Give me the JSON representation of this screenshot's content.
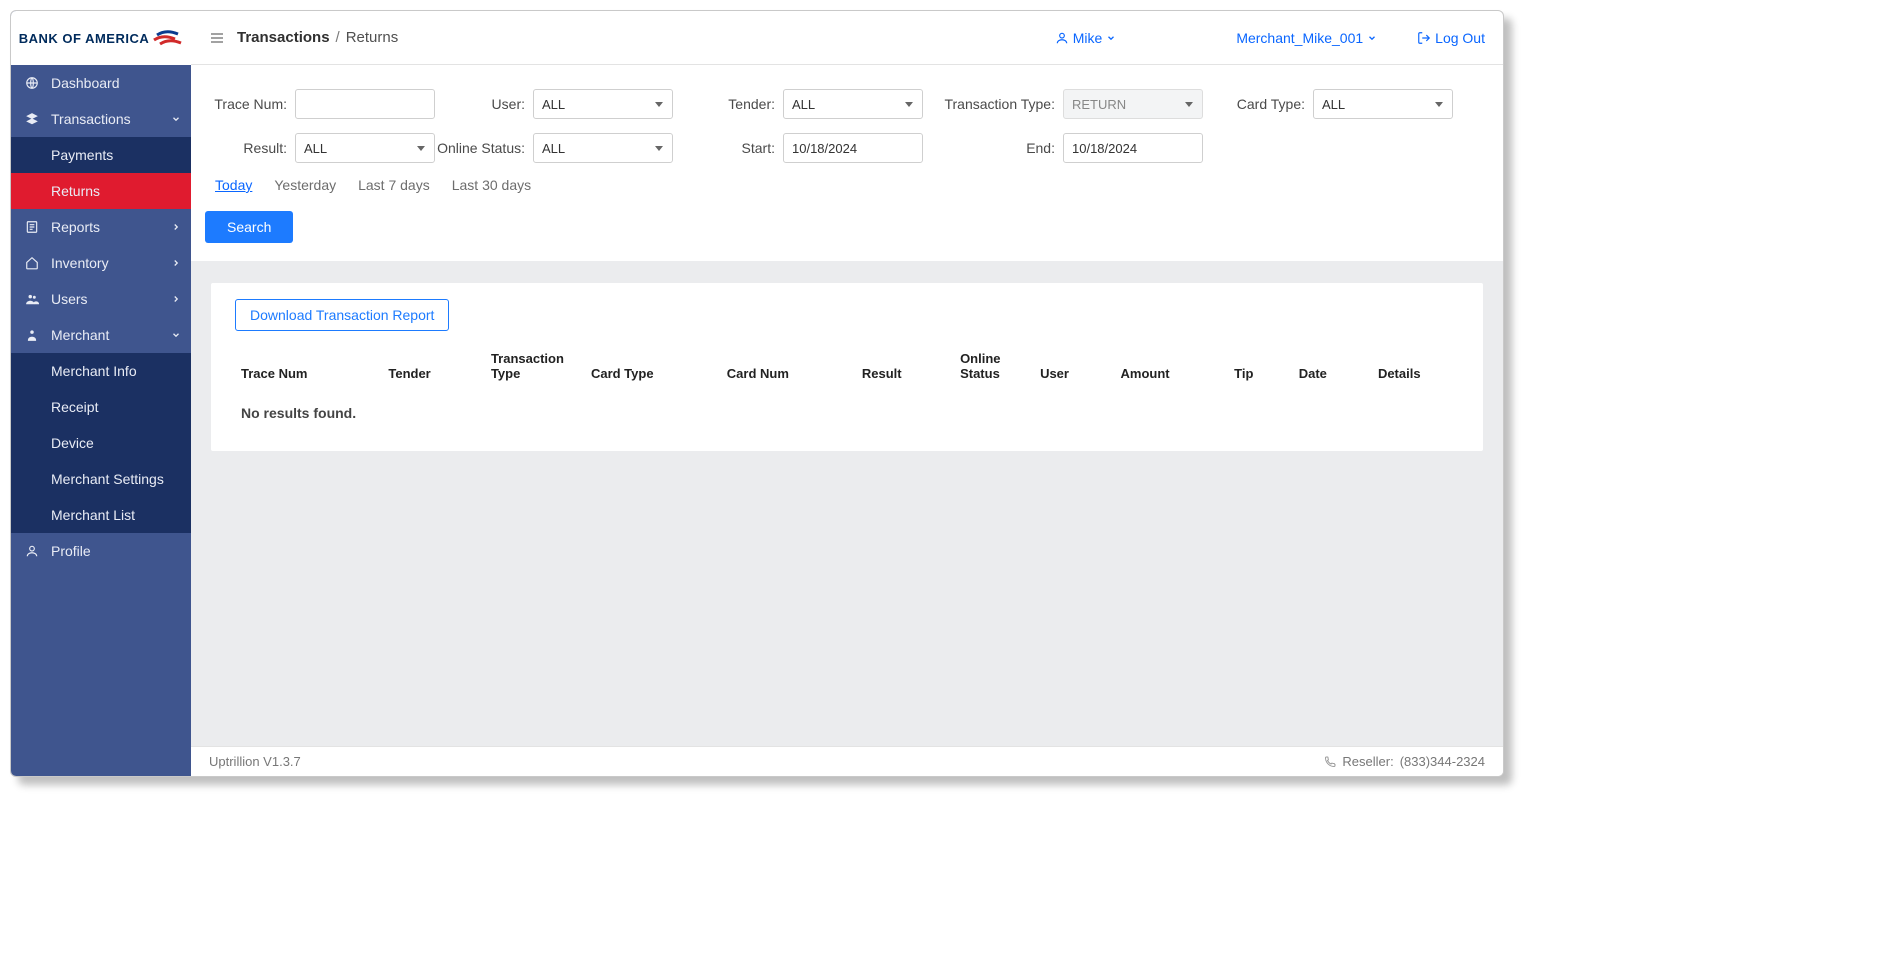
{
  "logo_text": "BANK OF AMERICA",
  "sidebar": {
    "items": [
      {
        "label": "Dashboard"
      },
      {
        "label": "Transactions"
      },
      {
        "label": "Payments"
      },
      {
        "label": "Returns"
      },
      {
        "label": "Reports"
      },
      {
        "label": "Inventory"
      },
      {
        "label": "Users"
      },
      {
        "label": "Merchant"
      },
      {
        "label": "Merchant Info"
      },
      {
        "label": "Receipt"
      },
      {
        "label": "Device"
      },
      {
        "label": "Merchant Settings"
      },
      {
        "label": "Merchant List"
      },
      {
        "label": "Profile"
      }
    ]
  },
  "breadcrumb": {
    "main": "Transactions",
    "sep": "/",
    "sub": "Returns"
  },
  "header": {
    "user": "Mike",
    "merchant": "Merchant_Mike_001",
    "logout": "Log Out"
  },
  "filters": {
    "trace_num": {
      "label": "Trace Num:",
      "value": ""
    },
    "user": {
      "label": "User:",
      "value": "ALL"
    },
    "tender": {
      "label": "Tender:",
      "value": "ALL"
    },
    "trans_type": {
      "label": "Transaction Type:",
      "value": "RETURN"
    },
    "card_type": {
      "label": "Card Type:",
      "value": "ALL"
    },
    "result": {
      "label": "Result:",
      "value": "ALL"
    },
    "online_status": {
      "label": "Online Status:",
      "value": "ALL"
    },
    "start": {
      "label": "Start:",
      "value": "10/18/2024"
    },
    "end": {
      "label": "End:",
      "value": "10/18/2024"
    }
  },
  "quick_links": {
    "today": "Today",
    "yesterday": "Yesterday",
    "last7": "Last 7 days",
    "last30": "Last 30 days"
  },
  "search_label": "Search",
  "download_label": "Download Transaction Report",
  "table_headers": {
    "trace_num": "Trace Num",
    "tender": "Tender",
    "trans_type": "Transaction Type",
    "card_type": "Card Type",
    "card_num": "Card Num",
    "result": "Result",
    "online_status": "Online Status",
    "user": "User",
    "amount": "Amount",
    "tip": "Tip",
    "date": "Date",
    "details": "Details"
  },
  "no_results": "No results found.",
  "footer": {
    "version": "Uptrillion V1.3.7",
    "reseller_label": "Reseller:",
    "reseller_phone": "(833)344-2324"
  }
}
